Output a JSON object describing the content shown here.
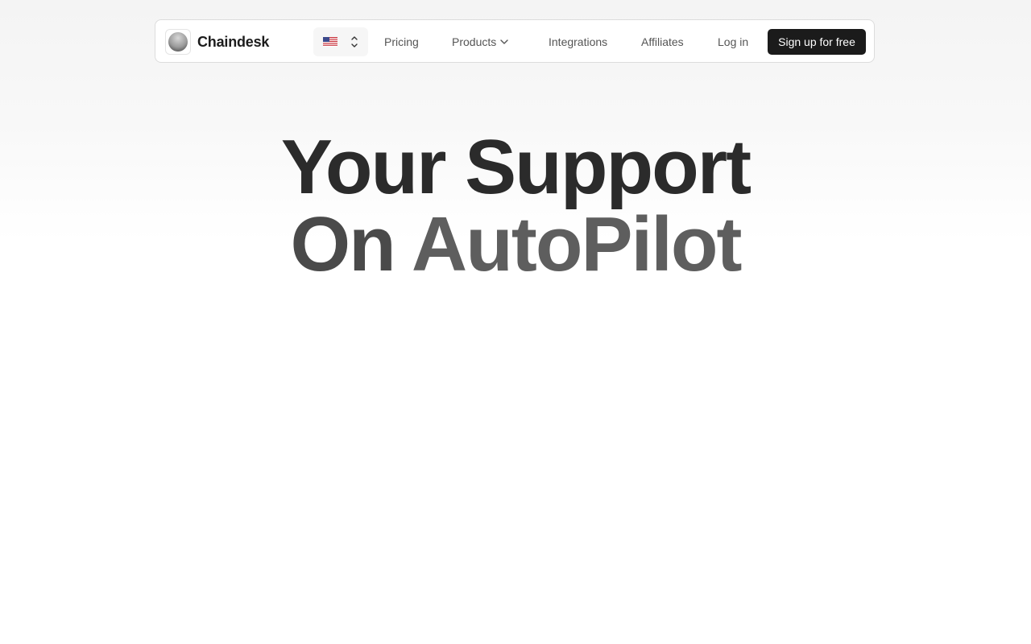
{
  "header": {
    "brand_name": "Chaindesk",
    "language_flag": "us-flag-icon",
    "nav": {
      "pricing": "Pricing",
      "products": "Products",
      "integrations": "Integrations",
      "affiliates": "Affiliates",
      "login": "Log in"
    },
    "signup_label": "Sign up for free"
  },
  "hero": {
    "line1": "Your Support",
    "line2_part1": "On ",
    "line2_part2": "AutoPilot"
  },
  "colors": {
    "primary_button": "#1b1b1b",
    "heading": "#2b2b2b",
    "nav_text": "#555555"
  }
}
